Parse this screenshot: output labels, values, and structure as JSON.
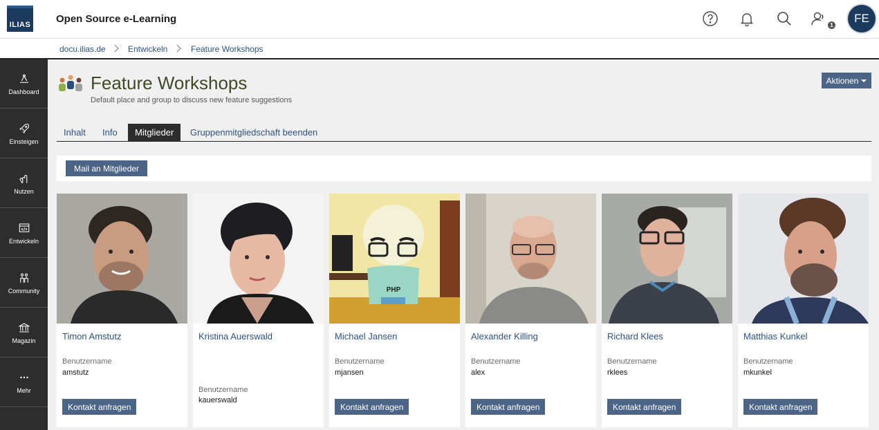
{
  "header": {
    "logo_text": "ILIAS",
    "site_title": "Open Source e-Learning",
    "avatar_initials": "FE",
    "notification_count": "1"
  },
  "breadcrumb": [
    "docu.ilias.de",
    "Entwickeln",
    "Feature Workshops"
  ],
  "sidebar": [
    {
      "label": "Dashboard",
      "icon": "dashboard-icon"
    },
    {
      "label": "Einsteigen",
      "icon": "rocket-icon"
    },
    {
      "label": "Nutzen",
      "icon": "hand-icon"
    },
    {
      "label": "Entwickeln",
      "icon": "code-icon"
    },
    {
      "label": "Community",
      "icon": "community-icon"
    },
    {
      "label": "Magazin",
      "icon": "library-icon"
    },
    {
      "label": "Mehr",
      "icon": "more-icon"
    }
  ],
  "page": {
    "title": "Feature Workshops",
    "description": "Default place and group to discuss new feature suggestions",
    "actions_label": "Aktionen"
  },
  "tabs": [
    "Inhalt",
    "Info",
    "Mitglieder",
    "Gruppenmitgliedschaft beenden"
  ],
  "active_tab": "Mitglieder",
  "toolbar": {
    "mail_label": "Mail an Mitglieder"
  },
  "members": [
    {
      "name": "Timon Amstutz",
      "username_label": "Benutzername",
      "username": "amstutz",
      "contact_label": "Kontakt anfragen"
    },
    {
      "name": "Kristina Auerswald",
      "username_label": "Benutzername",
      "username": "kauerswald",
      "contact_label": ""
    },
    {
      "name": "Michael Jansen",
      "username_label": "Benutzername",
      "username": "mjansen",
      "contact_label": "Kontakt anfragen"
    },
    {
      "name": "Alexander Killing",
      "username_label": "Benutzername",
      "username": "alex",
      "contact_label": "Kontakt anfragen"
    },
    {
      "name": "Richard Klees",
      "username_label": "Benutzername",
      "username": "rklees",
      "contact_label": "Kontakt anfragen"
    },
    {
      "name": "Matthias Kunkel",
      "username_label": "Benutzername",
      "username": "mkunkel",
      "contact_label": "Kontakt anfragen"
    }
  ],
  "avatar_text": "PHP"
}
